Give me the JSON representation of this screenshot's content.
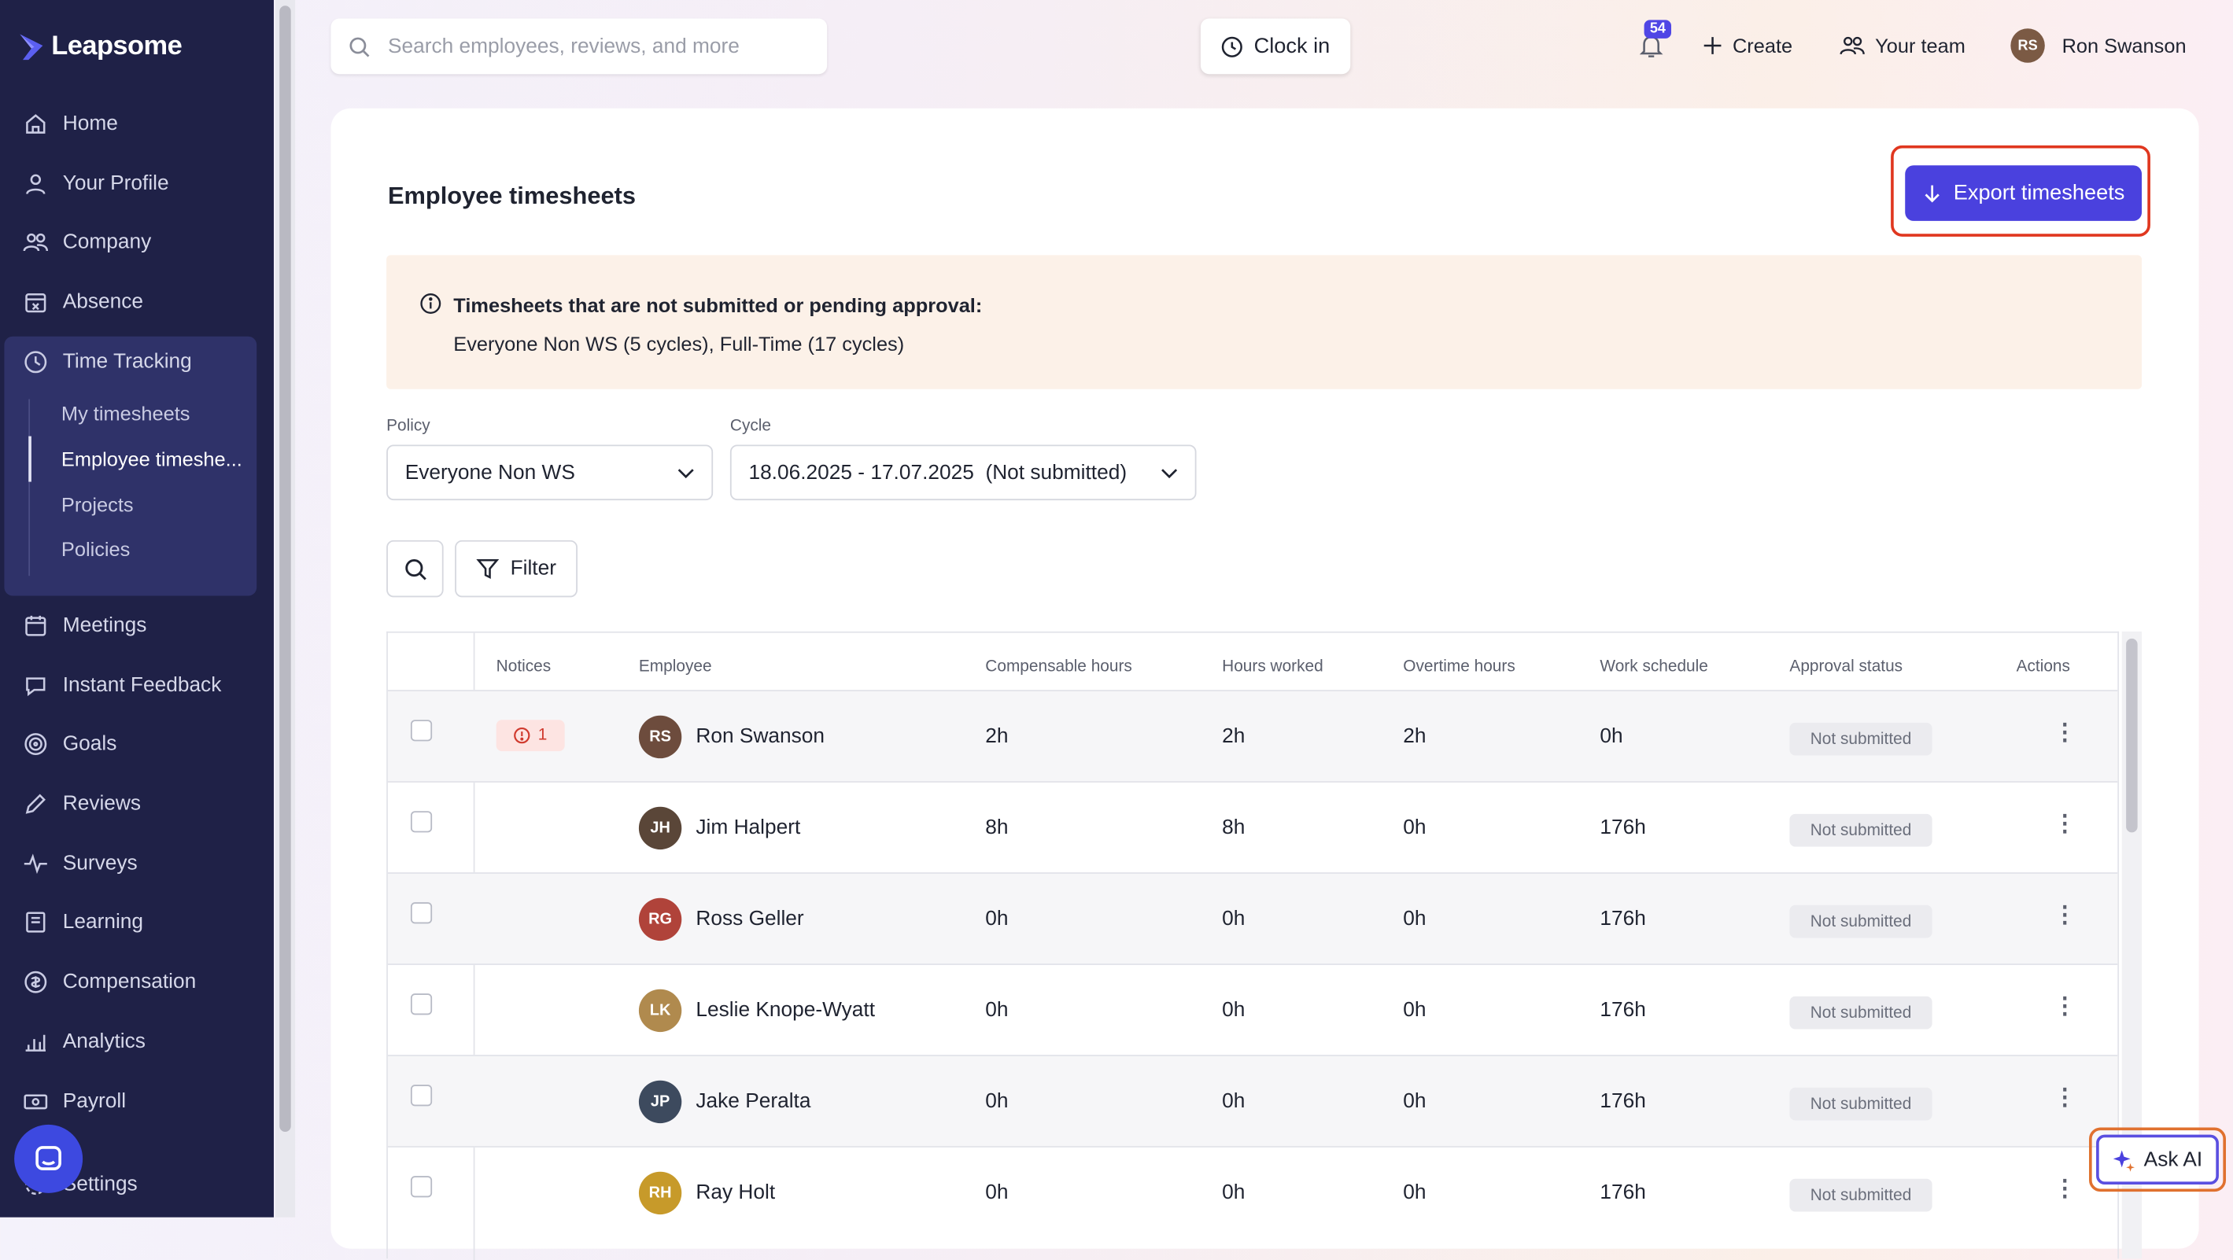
{
  "brand": {
    "name": "Leapsome"
  },
  "sidebar": {
    "items": [
      {
        "label": "Home",
        "icon": "home-icon"
      },
      {
        "label": "Your Profile",
        "icon": "user-icon"
      },
      {
        "label": "Company",
        "icon": "users-icon"
      },
      {
        "label": "Absence",
        "icon": "calendar-x-icon"
      },
      {
        "label": "Time Tracking",
        "icon": "clock-icon"
      },
      {
        "label": "Meetings",
        "icon": "calendar-icon"
      },
      {
        "label": "Instant Feedback",
        "icon": "chat-icon"
      },
      {
        "label": "Goals",
        "icon": "target-icon"
      },
      {
        "label": "Reviews",
        "icon": "pencil-icon"
      },
      {
        "label": "Surveys",
        "icon": "pulse-icon"
      },
      {
        "label": "Learning",
        "icon": "book-icon"
      },
      {
        "label": "Compensation",
        "icon": "coins-icon"
      },
      {
        "label": "Analytics",
        "icon": "chart-icon"
      },
      {
        "label": "Payroll",
        "icon": "money-icon"
      },
      {
        "label": "Settings",
        "icon": "gear-icon"
      }
    ],
    "time_tracking_sub": [
      {
        "label": "My timesheets"
      },
      {
        "label": "Employee timeshe..."
      },
      {
        "label": "Projects"
      },
      {
        "label": "Policies"
      }
    ]
  },
  "topbar": {
    "search_placeholder": "Search employees, reviews, and more",
    "clock_in": "Clock in",
    "notifications_count": "54",
    "create": "Create",
    "your_team": "Your team",
    "user_name": "Ron Swanson"
  },
  "page": {
    "title": "Employee timesheets",
    "export_button": "Export timesheets",
    "notice_title": "Timesheets that are not submitted or pending approval:",
    "notice_text": "Everyone Non WS (5 cycles), Full-Time (17 cycles)",
    "policy_label": "Policy",
    "policy_value": "Everyone Non WS",
    "cycle_label": "Cycle",
    "cycle_value": "18.06.2025 - 17.07.2025  (Not submitted)",
    "filter_label": "Filter"
  },
  "table": {
    "headers": {
      "notices": "Notices",
      "employee": "Employee",
      "compensable": "Compensable hours",
      "worked": "Hours worked",
      "overtime": "Overtime hours",
      "schedule": "Work schedule",
      "approval": "Approval status",
      "actions": "Actions"
    },
    "rows": [
      {
        "notice": "1",
        "name": "Ron Swanson",
        "compensable": "2h",
        "worked": "2h",
        "overtime": "2h",
        "schedule": "0h",
        "status": "Not submitted"
      },
      {
        "notice": "",
        "name": "Jim Halpert",
        "compensable": "8h",
        "worked": "8h",
        "overtime": "0h",
        "schedule": "176h",
        "status": "Not submitted"
      },
      {
        "notice": "",
        "name": "Ross Geller",
        "compensable": "0h",
        "worked": "0h",
        "overtime": "0h",
        "schedule": "176h",
        "status": "Not submitted"
      },
      {
        "notice": "",
        "name": "Leslie Knope-Wyatt",
        "compensable": "0h",
        "worked": "0h",
        "overtime": "0h",
        "schedule": "176h",
        "status": "Not submitted"
      },
      {
        "notice": "",
        "name": "Jake Peralta",
        "compensable": "0h",
        "worked": "0h",
        "overtime": "0h",
        "schedule": "176h",
        "status": "Not submitted"
      },
      {
        "notice": "",
        "name": "Ray Holt",
        "compensable": "0h",
        "worked": "0h",
        "overtime": "0h",
        "schedule": "176h",
        "status": "Not submitted"
      }
    ]
  },
  "ask_ai": {
    "label": "Ask AI"
  },
  "colors": {
    "sidebar_bg": "#1f2147",
    "accent": "#4a41de",
    "highlight_outline": "#e0371f",
    "notice_bg": "#fcf1e8"
  }
}
